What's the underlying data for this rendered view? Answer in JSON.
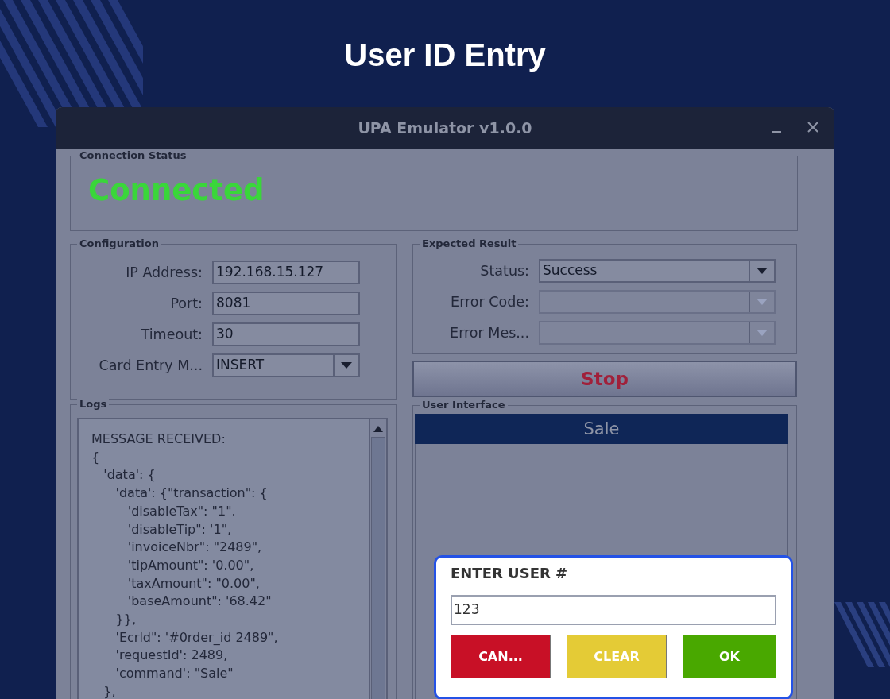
{
  "page": {
    "title": "User ID Entry"
  },
  "window": {
    "title": "UPA Emulator v1.0.0"
  },
  "connection_status": {
    "legend": "Connection Status",
    "value": "Connected",
    "color": "#3ad63a"
  },
  "configuration": {
    "legend": "Configuration",
    "fields": [
      {
        "label": "IP Address:",
        "value": "192.168.15.127",
        "kind": "text"
      },
      {
        "label": "Port:",
        "value": "8081",
        "kind": "text"
      },
      {
        "label": "Timeout:",
        "value": "30",
        "kind": "text"
      },
      {
        "label": "Card Entry M...",
        "value": "INSERT",
        "kind": "combo"
      }
    ]
  },
  "expected_result": {
    "legend": "Expected Result",
    "fields": [
      {
        "label": "Status:",
        "value": "Success",
        "disabled": false
      },
      {
        "label": "Error Code:",
        "disabled": true
      },
      {
        "label": "Error Mes...",
        "disabled": true
      }
    ]
  },
  "stop_button": {
    "label": "Stop"
  },
  "logs": {
    "legend": "Logs",
    "text": "MESSAGE RECEIVED:\n{\n   'data': {\n      'data': {\"transaction\": {\n         'disableTax\": \"1\".\n         'disableTip\": '1\",\n         'invoiceNbr\": \"2489\",\n         'tipAmount\": '0.00\",\n         'taxAmount\": \"0.00\",\n         'baseAmount\": '68.42\"\n      }},\n      'Ecrld\": '#0rder_id 2489\",\n      'requestId': 2489,\n      'command': \"Sale\"\n   },"
  },
  "user_interface": {
    "legend": "User Interface",
    "header": "Sale",
    "dialog": {
      "prompt": "ENTER USER #",
      "value": "123",
      "buttons": [
        {
          "label": "CAN...",
          "kind": "cancel"
        },
        {
          "label": "CLEAR",
          "kind": "clear"
        },
        {
          "label": "OK",
          "kind": "ok"
        }
      ]
    }
  }
}
